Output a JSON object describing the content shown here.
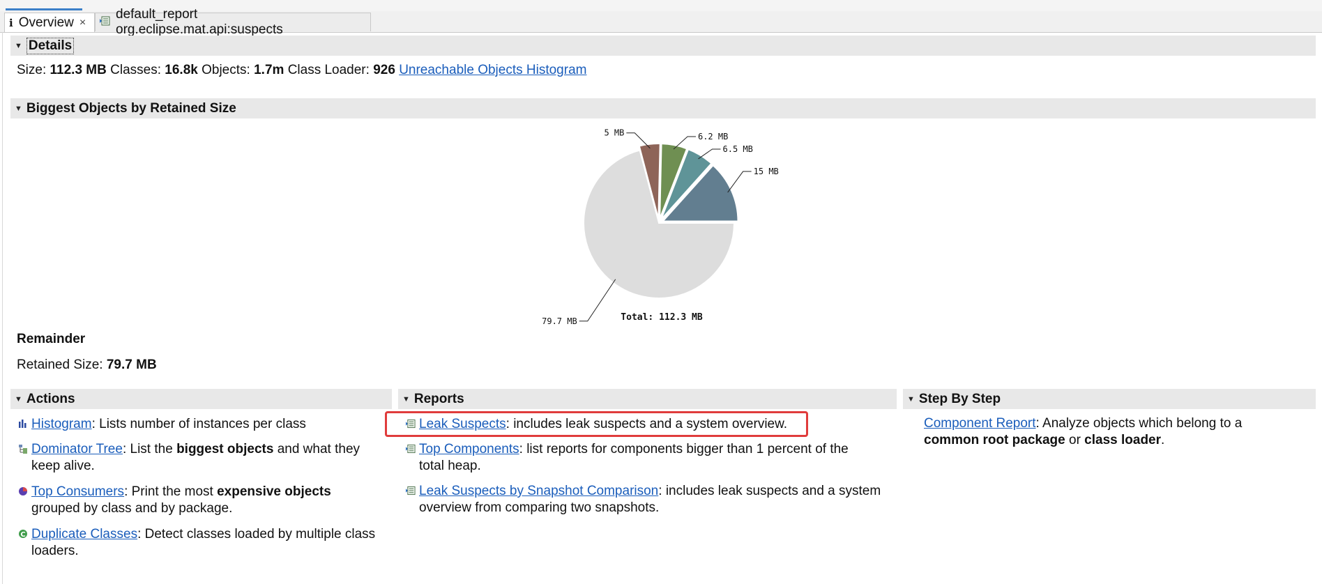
{
  "tabs": [
    {
      "label": "Overview",
      "icon": "info-icon",
      "active": true,
      "closable": true
    },
    {
      "label": "default_report org.eclipse.mat.api:suspects",
      "icon": "report-icon",
      "active": false
    }
  ],
  "details": {
    "title": "Details",
    "size_label": "Size:",
    "size_value": "112.3 MB",
    "classes_label": "Classes:",
    "classes_value": "16.8k",
    "objects_label": "Objects:",
    "objects_value": "1.7m",
    "classloader_label": "Class Loader:",
    "classloader_value": "926",
    "link": "Unreachable Objects Histogram"
  },
  "biggest": {
    "title": "Biggest Objects by Retained Size"
  },
  "chart_data": {
    "type": "pie",
    "slices": [
      {
        "label": "15 MB",
        "value": 15,
        "color": "#627e90"
      },
      {
        "label": "6.5 MB",
        "value": 6.5,
        "color": "#5f9498"
      },
      {
        "label": "6.2 MB",
        "value": 6.2,
        "color": "#6f8f52"
      },
      {
        "label": "5 MB",
        "value": 5,
        "color": "#8e6458"
      },
      {
        "label": "79.7 MB",
        "value": 79.7,
        "color": "#dddddd"
      }
    ],
    "total_label": "Total: 112.3 MB"
  },
  "remainder": {
    "title": "Remainder",
    "retained_label": "Retained Size:",
    "retained_value": "79.7 MB"
  },
  "actions": {
    "title": "Actions",
    "items": [
      {
        "link": "Histogram",
        "text": ": Lists number of instances per class",
        "icon": "histogram-icon"
      },
      {
        "link": "Dominator Tree",
        "pre": ": List the ",
        "bold": "biggest objects",
        "post": " and what they",
        "line2": "keep alive.",
        "icon": "dominator-tree-icon"
      },
      {
        "link": "Top Consumers",
        "pre": ": Print the most ",
        "bold": "expensive objects",
        "line2": "grouped by class and by package.",
        "icon": "top-consumers-icon"
      },
      {
        "link": "Duplicate Classes",
        "text": ": Detect classes loaded by multiple class",
        "line2": "loaders.",
        "icon": "duplicate-classes-icon"
      }
    ]
  },
  "reports": {
    "title": "Reports",
    "items": [
      {
        "link": "Leak Suspects",
        "text": ": includes leak suspects and a system overview.",
        "icon": "report-icon"
      },
      {
        "link": "Top Components",
        "text": ": list reports for components bigger than 1 percent of the",
        "line2": "total heap.",
        "icon": "report-icon"
      },
      {
        "link": "Leak Suspects by Snapshot Comparison",
        "text": ": includes leak suspects and a system",
        "line2": "overview from comparing two snapshots.",
        "icon": "report-icon"
      }
    ]
  },
  "stepbystep": {
    "title": "Step By Step",
    "link": "Component Report",
    "text": ": Analyze objects which belong to a",
    "bold1": "common root package",
    "mid": " or ",
    "bold2": "class loader",
    "end": "."
  }
}
